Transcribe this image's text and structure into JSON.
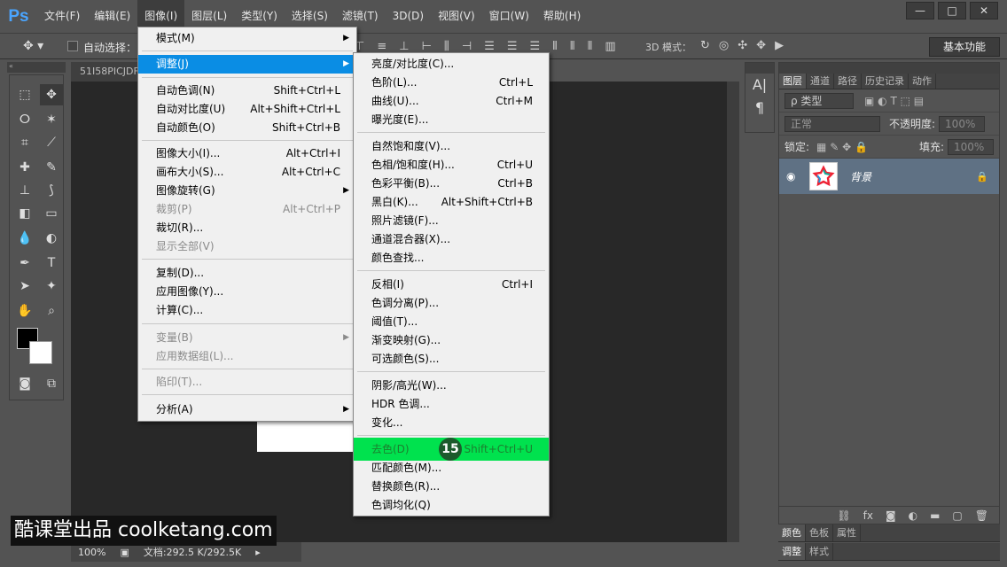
{
  "app": {
    "logo": "Ps"
  },
  "menubar": {
    "items": [
      "文件(F)",
      "编辑(E)",
      "图像(I)",
      "图层(L)",
      "类型(Y)",
      "选择(S)",
      "滤镜(T)",
      "3D(D)",
      "视图(V)",
      "窗口(W)",
      "帮助(H)"
    ]
  },
  "window": {
    "minimize": "—",
    "restore": "□",
    "close": "✕"
  },
  "options": {
    "auto_select_label": "自动选择：",
    "mode3d_label": "3D 模式：",
    "workspace": "基本功能"
  },
  "document": {
    "tab": "51I58PICJDF",
    "zoom": "100%",
    "docinfo": "文档:292.5 K/292.5K"
  },
  "image_menu": {
    "items": [
      {
        "label": "模式(M)",
        "shortcut": "",
        "submenu": true,
        "disabled": false
      },
      {
        "label": "调整(J)",
        "shortcut": "",
        "submenu": true,
        "disabled": false,
        "highlighted": true
      },
      {
        "label": "自动色调(N)",
        "shortcut": "Shift+Ctrl+L",
        "disabled": false
      },
      {
        "label": "自动对比度(U)",
        "shortcut": "Alt+Shift+Ctrl+L",
        "disabled": false
      },
      {
        "label": "自动颜色(O)",
        "shortcut": "Shift+Ctrl+B",
        "disabled": false
      },
      {
        "label": "图像大小(I)...",
        "shortcut": "Alt+Ctrl+I",
        "disabled": false
      },
      {
        "label": "画布大小(S)...",
        "shortcut": "Alt+Ctrl+C",
        "disabled": false
      },
      {
        "label": "图像旋转(G)",
        "shortcut": "",
        "submenu": true,
        "disabled": false
      },
      {
        "label": "裁剪(P)",
        "shortcut": "Alt+Ctrl+P",
        "disabled": true
      },
      {
        "label": "裁切(R)...",
        "shortcut": "",
        "disabled": false
      },
      {
        "label": "显示全部(V)",
        "shortcut": "",
        "disabled": true
      },
      {
        "label": "复制(D)...",
        "shortcut": "",
        "disabled": false
      },
      {
        "label": "应用图像(Y)...",
        "shortcut": "",
        "disabled": false
      },
      {
        "label": "计算(C)...",
        "shortcut": "",
        "disabled": false
      },
      {
        "label": "变量(B)",
        "shortcut": "",
        "submenu": true,
        "disabled": true
      },
      {
        "label": "应用数据组(L)...",
        "shortcut": "",
        "disabled": true
      },
      {
        "label": "陷印(T)...",
        "shortcut": "",
        "disabled": true
      },
      {
        "label": "分析(A)",
        "shortcut": "",
        "submenu": true,
        "disabled": false
      }
    ]
  },
  "adjust_menu": {
    "items": [
      {
        "label": "亮度/对比度(C)...",
        "shortcut": ""
      },
      {
        "label": "色阶(L)...",
        "shortcut": "Ctrl+L"
      },
      {
        "label": "曲线(U)...",
        "shortcut": "Ctrl+M"
      },
      {
        "label": "曝光度(E)...",
        "shortcut": ""
      },
      {
        "label": "自然饱和度(V)...",
        "shortcut": ""
      },
      {
        "label": "色相/饱和度(H)...",
        "shortcut": "Ctrl+U"
      },
      {
        "label": "色彩平衡(B)...",
        "shortcut": "Ctrl+B"
      },
      {
        "label": "黑白(K)...",
        "shortcut": "Alt+Shift+Ctrl+B"
      },
      {
        "label": "照片滤镜(F)...",
        "shortcut": ""
      },
      {
        "label": "通道混合器(X)...",
        "shortcut": ""
      },
      {
        "label": "颜色查找...",
        "shortcut": ""
      },
      {
        "label": "反相(I)",
        "shortcut": "Ctrl+I"
      },
      {
        "label": "色调分离(P)...",
        "shortcut": ""
      },
      {
        "label": "阈值(T)...",
        "shortcut": ""
      },
      {
        "label": "渐变映射(G)...",
        "shortcut": ""
      },
      {
        "label": "可选颜色(S)...",
        "shortcut": ""
      },
      {
        "label": "阴影/高光(W)...",
        "shortcut": ""
      },
      {
        "label": "HDR 色调...",
        "shortcut": ""
      },
      {
        "label": "变化...",
        "shortcut": ""
      },
      {
        "label": "去色(D)",
        "shortcut": "Shift+Ctrl+U",
        "step": "15"
      },
      {
        "label": "匹配颜色(M)...",
        "shortcut": ""
      },
      {
        "label": "替换颜色(R)...",
        "shortcut": ""
      },
      {
        "label": "色调均化(Q)",
        "shortcut": ""
      }
    ]
  },
  "layers_panel": {
    "tabs": [
      "图层",
      "通道",
      "路径",
      "历史记录",
      "动作"
    ],
    "kind_filter": "ρ 类型",
    "blend_mode": "正常",
    "opacity_label": "不透明度:",
    "opacity_value": "100%",
    "lock_label": "锁定:",
    "fill_label": "填充:",
    "fill_value": "100%",
    "layer_name": "背景"
  },
  "bottom_tabs_1": [
    "颜色",
    "色板",
    "属性"
  ],
  "bottom_tabs_2": [
    "调整",
    "样式"
  ],
  "watermark": "酷课堂出品 coolketang.com"
}
